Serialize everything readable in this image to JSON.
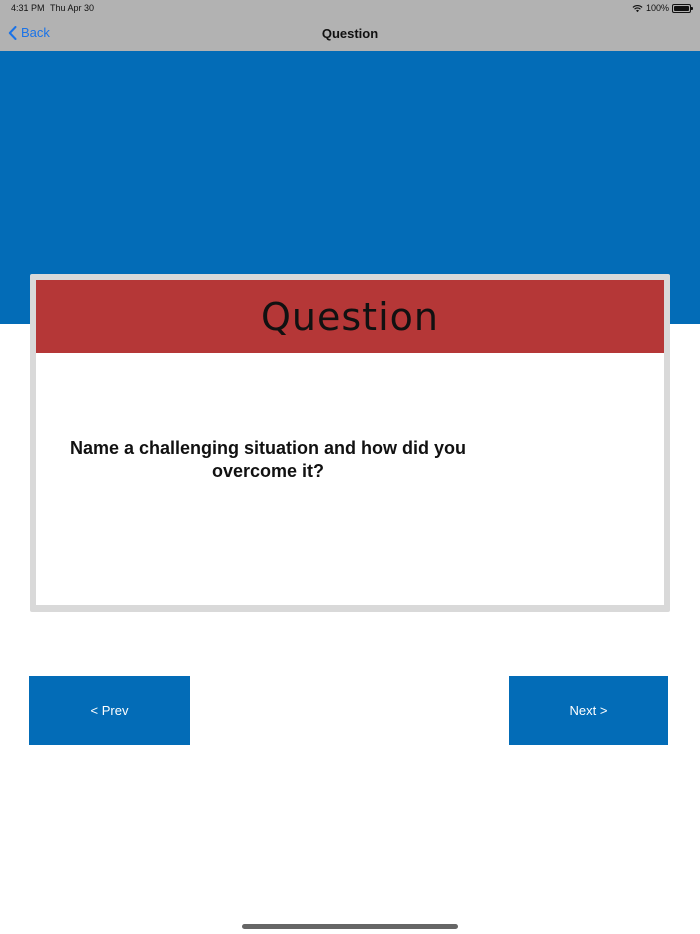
{
  "status_bar": {
    "time": "4:31 PM",
    "date": "Thu Apr 30",
    "battery": "100%",
    "wifi_icon": "wifi-icon",
    "battery_icon": "battery-icon"
  },
  "nav": {
    "back_label": "Back",
    "back_icon": "chevron-left-icon",
    "title": "Question"
  },
  "card": {
    "header": "Question",
    "question": "Name a challenging situation and how did you overcome it?"
  },
  "buttons": {
    "prev_label": "< Prev",
    "next_label": "Next >"
  },
  "colors": {
    "banner": "#036cb7",
    "card_header": "#b53737",
    "nav_bar": "#b2b2b2",
    "link": "#1a73e8"
  }
}
